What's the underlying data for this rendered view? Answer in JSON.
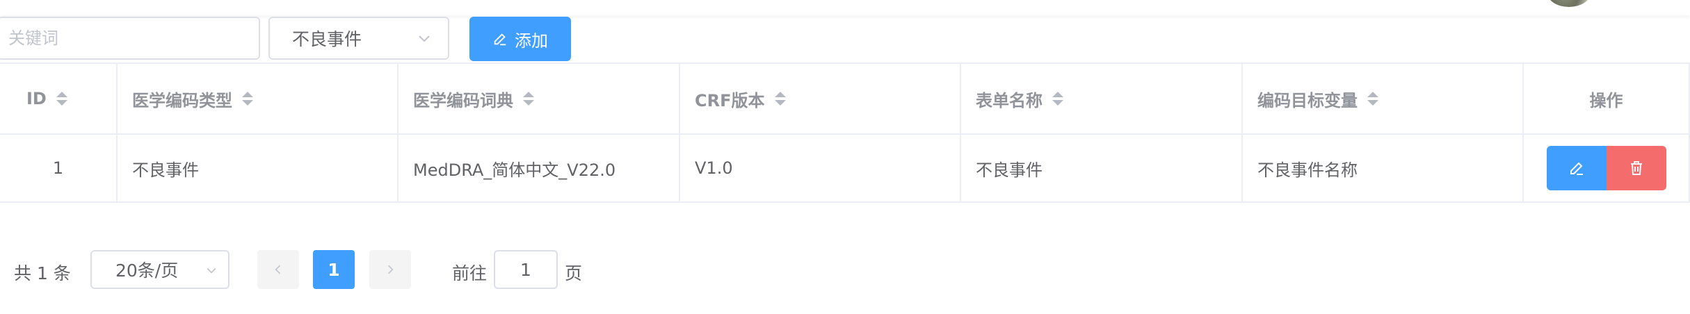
{
  "toolbar": {
    "search_placeholder": "关键词",
    "search_value": "",
    "type_select_value": "不良事件",
    "add_label": "添加"
  },
  "table": {
    "columns": [
      "ID",
      "医学编码类型",
      "医学编码词典",
      "CRF版本",
      "表单名称",
      "编码目标变量",
      "操作"
    ],
    "rows": [
      {
        "id": "1",
        "coding_type": "不良事件",
        "dictionary": "MedDRA_简体中文_V22.0",
        "crf_version": "V1.0",
        "form_name": "不良事件",
        "target_variable": "不良事件名称"
      }
    ]
  },
  "pagination": {
    "total_label": "共 1 条",
    "page_size_label": "20条/页",
    "current_page": "1",
    "goto_prefix": "前往",
    "goto_value": "1",
    "goto_suffix": "页"
  },
  "colors": {
    "primary": "#409eff",
    "danger": "#f56c6c",
    "border": "#ebeef5"
  }
}
